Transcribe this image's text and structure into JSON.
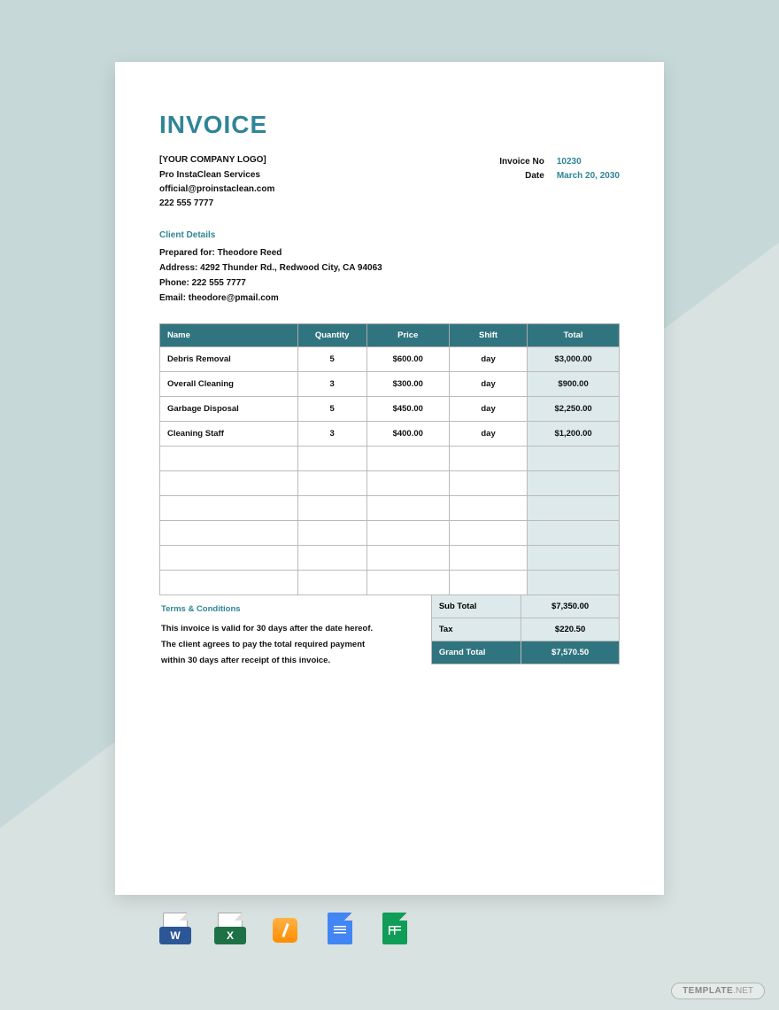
{
  "title": "INVOICE",
  "company": {
    "logo_placeholder": "[YOUR COMPANY LOGO]",
    "name": "Pro InstaClean Services",
    "email": "official@proinstaclean.com",
    "phone": "222 555 7777"
  },
  "meta": {
    "invoice_no_label": "Invoice No",
    "invoice_no": "10230",
    "date_label": "Date",
    "date": "March 20, 2030"
  },
  "client": {
    "heading": "Client Details",
    "prepared_label": "Prepared for:",
    "prepared_for": "Theodore Reed",
    "address_label": "Address:",
    "address": "4292 Thunder Rd., Redwood City, CA 94063",
    "phone_label": "Phone:",
    "phone": "222 555 7777",
    "email_label": "Email:",
    "email": "theodore@pmail.com"
  },
  "table": {
    "headers": {
      "name": "Name",
      "qty": "Quantity",
      "price": "Price",
      "shift": "Shift",
      "total": "Total"
    },
    "rows": [
      {
        "name": "Debris Removal",
        "qty": "5",
        "price": "$600.00",
        "shift": "day",
        "total": "$3,000.00"
      },
      {
        "name": "Overall Cleaning",
        "qty": "3",
        "price": "$300.00",
        "shift": "day",
        "total": "$900.00"
      },
      {
        "name": "Garbage Disposal",
        "qty": "5",
        "price": "$450.00",
        "shift": "day",
        "total": "$2,250.00"
      },
      {
        "name": "Cleaning Staff",
        "qty": "3",
        "price": "$400.00",
        "shift": "day",
        "total": "$1,200.00"
      },
      {
        "name": "",
        "qty": "",
        "price": "",
        "shift": "",
        "total": ""
      },
      {
        "name": "",
        "qty": "",
        "price": "",
        "shift": "",
        "total": ""
      },
      {
        "name": "",
        "qty": "",
        "price": "",
        "shift": "",
        "total": ""
      },
      {
        "name": "",
        "qty": "",
        "price": "",
        "shift": "",
        "total": ""
      },
      {
        "name": "",
        "qty": "",
        "price": "",
        "shift": "",
        "total": ""
      },
      {
        "name": "",
        "qty": "",
        "price": "",
        "shift": "",
        "total": ""
      }
    ]
  },
  "terms": {
    "heading": "Terms & Conditions",
    "line1": "This invoice is valid for 30 days after the date hereof.",
    "line2": "The client agrees to pay the total required payment",
    "line3": "within 30 days after receipt of this invoice."
  },
  "summary": {
    "subtotal_label": "Sub Total",
    "subtotal": "$7,350.00",
    "tax_label": "Tax",
    "tax": "$220.50",
    "grand_label": "Grand Total",
    "grand": "$7,570.50"
  },
  "watermark": {
    "brand": "TEMPLATE",
    "suffix": ".NET"
  }
}
